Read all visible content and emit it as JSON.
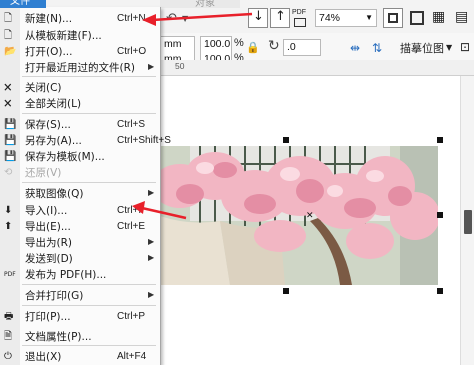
{
  "toolbar": {
    "zoom_value": "74%",
    "field_mm1": "mm",
    "field_mm2": "mm",
    "pct1": "100.0",
    "pct2": "100.0",
    "pct_sign": "%",
    "rotation": ".0",
    "trace_label": "描摹位图",
    "pdf_label": "PDF",
    "obscured_menu": "文件",
    "obscured_menu_extra": "对象"
  },
  "ruler": {
    "label": "50"
  },
  "menu": {
    "items": [
      {
        "label": "新建(N)...",
        "shortcut": "Ctrl+N",
        "icon": "new-document-icon"
      },
      {
        "label": "从模板新建(F)...",
        "shortcut": "",
        "icon": "new-from-template-icon"
      },
      {
        "label": "打开(O)...",
        "shortcut": "Ctrl+O",
        "icon": "open-folder-icon"
      },
      {
        "label": "打开最近用过的文件(R)",
        "shortcut": "",
        "icon": "",
        "submenu": true
      },
      {
        "label": "关闭(C)",
        "shortcut": "",
        "icon": "close-document-icon"
      },
      {
        "label": "全部关闭(L)",
        "shortcut": "",
        "icon": "close-all-icon"
      },
      {
        "label": "保存(S)...",
        "shortcut": "Ctrl+S",
        "icon": "save-icon"
      },
      {
        "label": "另存为(A)...",
        "shortcut": "Ctrl+Shift+S",
        "icon": "save-as-icon"
      },
      {
        "label": "保存为模板(M)...",
        "shortcut": "",
        "icon": "save-as-template-icon"
      },
      {
        "label": "还原(V)",
        "shortcut": "",
        "icon": "revert-icon",
        "disabled": true
      },
      {
        "label": "获取图像(Q)",
        "shortcut": "",
        "icon": "",
        "submenu": true
      },
      {
        "label": "导入(I)...",
        "shortcut": "Ctrl+I",
        "icon": "import-icon"
      },
      {
        "label": "导出(E)...",
        "shortcut": "Ctrl+E",
        "icon": "export-icon"
      },
      {
        "label": "导出为(R)",
        "shortcut": "",
        "icon": "",
        "submenu": true
      },
      {
        "label": "发送到(D)",
        "shortcut": "",
        "icon": "",
        "submenu": true
      },
      {
        "label": "发布为 PDF(H)...",
        "shortcut": "",
        "icon": "pdf-icon"
      },
      {
        "label": "合并打印(G)",
        "shortcut": "",
        "icon": "",
        "submenu": true
      },
      {
        "label": "打印(P)...",
        "shortcut": "Ctrl+P",
        "icon": "print-icon"
      },
      {
        "label": "文档属性(P)...",
        "shortcut": "",
        "icon": "document-properties-icon"
      },
      {
        "label": "退出(X)",
        "shortcut": "Alt+F4",
        "icon": "exit-icon"
      }
    ],
    "submenu_arrow": "▶"
  },
  "colors": {
    "annotation_arrow": "#e8202a",
    "menu_highlight": "#2f7fd1"
  }
}
